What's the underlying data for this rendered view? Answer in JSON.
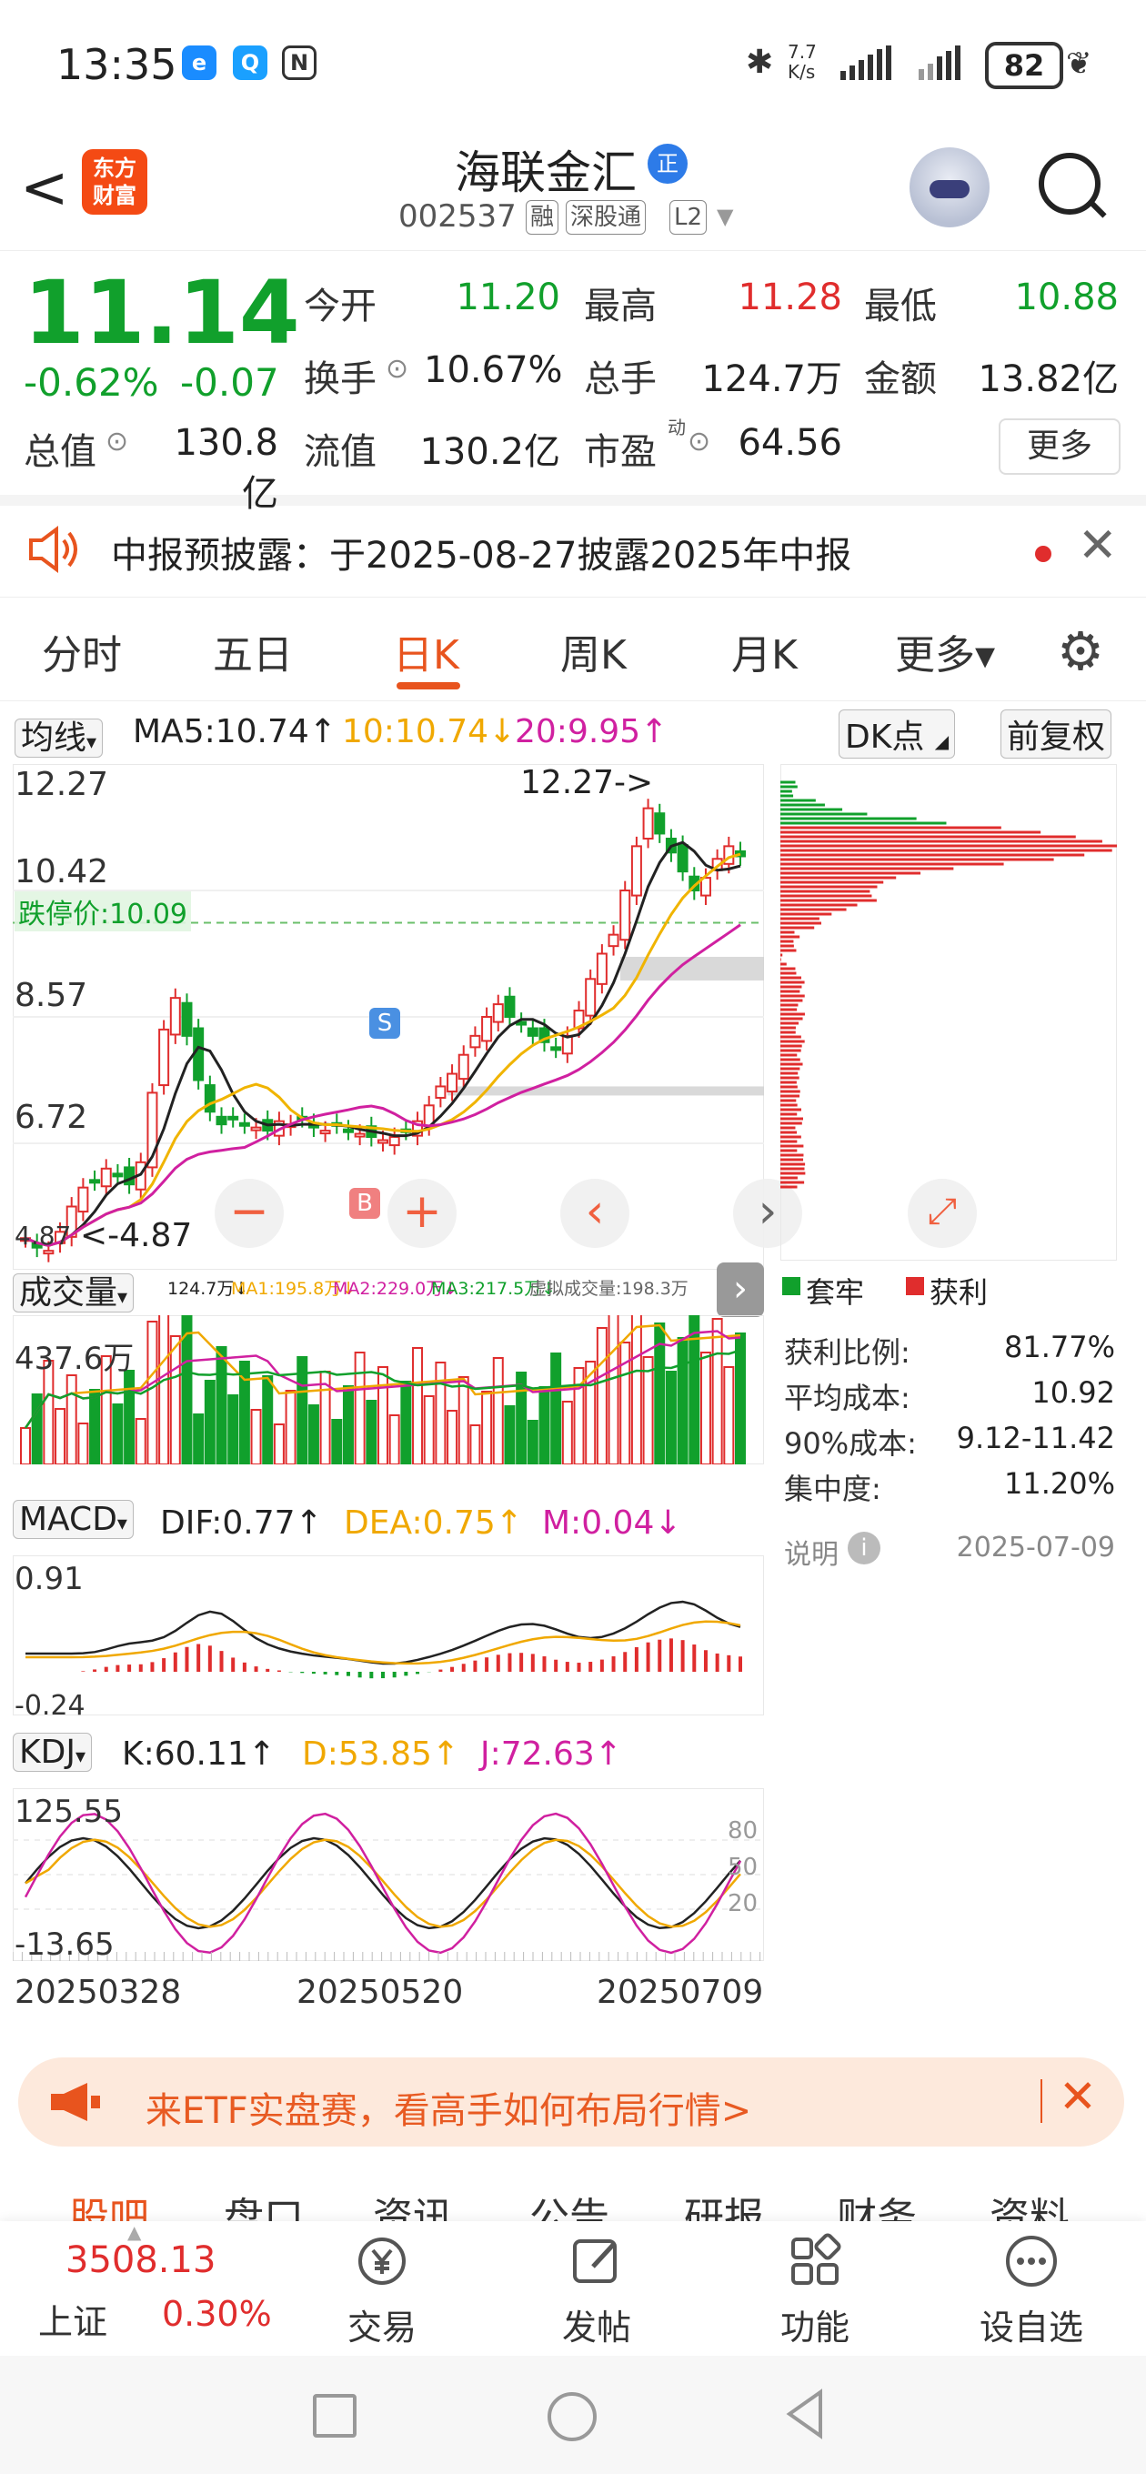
{
  "status_bar": {
    "time": "13:35",
    "net_speed": "7.7\nK/s",
    "battery": "82"
  },
  "header": {
    "stock_name": "海联金汇",
    "stock_code": "002537",
    "tags": [
      "融",
      "深股通",
      "L2"
    ],
    "logo_text": "东方\n财富",
    "zheng_badge": "正"
  },
  "quote": {
    "price": "11.14",
    "change_pct": "-0.62%",
    "change_amt": "-0.07",
    "open_label": "今开",
    "open": "11.20",
    "high_label": "最高",
    "high": "11.28",
    "low_label": "最低",
    "low": "10.88",
    "turnover_label": "换手",
    "turnover": "10.67%",
    "volume_label": "总手",
    "volume": "124.7万",
    "amount_label": "金额",
    "amount": "13.82亿",
    "mktcap_label": "总值",
    "mktcap": "130.8亿",
    "float_label": "流值",
    "float_cap": "130.2亿",
    "pe_label": "市盈",
    "pe_sup": "动",
    "pe": "64.56",
    "more_label": "更多"
  },
  "notice": {
    "text": "中报预披露：于2025-08-27披露2025年中报"
  },
  "tabs": [
    {
      "label": "分时"
    },
    {
      "label": "五日"
    },
    {
      "label": "日K"
    },
    {
      "label": "周K"
    },
    {
      "label": "月K"
    },
    {
      "label": "更多▾"
    }
  ],
  "indicators": {
    "ma_select": "均线",
    "ma5": "MA5:10.74↑",
    "ma10": "10:10.74↓",
    "ma20": "20:9.95↑",
    "dk_button": "DK点",
    "adjust_button": "前复权",
    "price_ticks": [
      "12.27",
      "10.42",
      "8.57",
      "6.72",
      "4.87"
    ],
    "limit_down": "跌停价:10.09",
    "high_marker": "12.27->",
    "low_marker": "<-4.87",
    "b_marker": "B",
    "s_marker": "S",
    "vol_select": "成交量",
    "vol_line": "124.7万↓",
    "vol_ma1": "MA1:195.8万↓",
    "vol_ma2": "MA2:229.0万↓",
    "vol_ma3": "MA3:217.5万↓",
    "vol_virtual": "虚拟成交量:198.3万",
    "vol_tick": "437.6万",
    "macd_select": "MACD",
    "dif": "DIF:0.77↑",
    "dea": "DEA:0.75↑",
    "m": "M:0.04↓",
    "macd_top": "0.91",
    "macd_bottom": "-0.24",
    "kdj_select": "KDJ",
    "k": "K:60.11↑",
    "d": "D:53.85↑",
    "j": "J:72.63↑",
    "kdj_top": "125.55",
    "kdj_bottom": "-13.65",
    "kdj_80": "80",
    "kdj_50": "50",
    "kdj_20": "20",
    "dates": [
      "20250328",
      "20250520",
      "20250709"
    ]
  },
  "chips": {
    "trapped_label": "套牢",
    "profit_label": "获利",
    "profit_ratio_label": "获利比例:",
    "profit_ratio": "81.77%",
    "avg_cost_label": "平均成本:",
    "avg_cost": "10.92",
    "cost90_label": "90%成本:",
    "cost90": "9.12-11.42",
    "concentration_label": "集中度:",
    "concentration": "11.20%",
    "explain_label": "说明",
    "date": "2025-07-09"
  },
  "banner": {
    "text": "来ETF实盘赛，看高手如何布局行情>"
  },
  "subtabs": [
    "股吧",
    "盘口",
    "资讯",
    "公告",
    "研报",
    "财务",
    "资料"
  ],
  "bottom": {
    "index_value": "3508.13",
    "index_name": "上证",
    "index_change": "0.30%",
    "nav": [
      "交易",
      "发帖",
      "功能",
      "设自选"
    ]
  },
  "colors": {
    "up": "#e02d2d",
    "down": "#11a02c",
    "accent": "#e8541e",
    "ma5": "#222222",
    "ma10": "#f0b400",
    "ma20": "#d020a0"
  }
}
